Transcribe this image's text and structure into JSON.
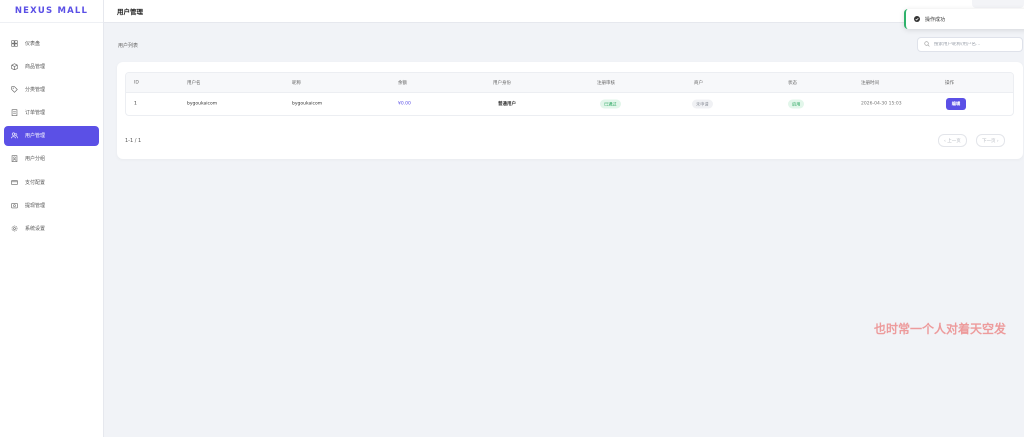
{
  "brand": "NEXUS MALL",
  "header": {
    "title": "用户管理"
  },
  "toast": {
    "message": "操作成功",
    "icon": "check-circle-icon"
  },
  "sidebar": {
    "items": [
      {
        "label": "仪表盘",
        "icon": "dashboard-icon",
        "active": false
      },
      {
        "label": "商品管理",
        "icon": "box-icon",
        "active": false
      },
      {
        "label": "分类管理",
        "icon": "tag-icon",
        "active": false
      },
      {
        "label": "订单管理",
        "icon": "clipboard-icon",
        "active": false
      },
      {
        "label": "用户管理",
        "icon": "users-icon",
        "active": true
      },
      {
        "label": "用户分组",
        "icon": "user-group-icon",
        "active": false
      },
      {
        "label": "支付配置",
        "icon": "card-icon",
        "active": false
      },
      {
        "label": "提现管理",
        "icon": "wallet-icon",
        "active": false
      },
      {
        "label": "系统设置",
        "icon": "gear-icon",
        "active": false
      }
    ]
  },
  "list": {
    "title": "用户列表"
  },
  "search": {
    "placeholder": "搜索用户昵称/用户名...",
    "value": ""
  },
  "table": {
    "headers": [
      "ID",
      "用户名",
      "昵称",
      "余额",
      "用户身份",
      "注册审核",
      "商户",
      "状态",
      "注册时间",
      "操作"
    ],
    "rows": [
      {
        "id": "1",
        "username": "bygoukaicom",
        "nickname": "bygoukaicom",
        "balance": "¥0.00",
        "role": "普通用户",
        "review": "已通过",
        "merchant": "未申请",
        "status": "启用",
        "registered": "2026-04-30 15:03",
        "action": "编辑"
      }
    ]
  },
  "pagination": {
    "info": "1-1 / 1",
    "prev": "‹ 上一页",
    "next": "下一页 ›"
  },
  "watermark": "也时常一个人对着天空发",
  "colors": {
    "accent": "#5b50e6",
    "success": "#23a35a",
    "toast_border": "#2fb26b",
    "watermark": "#ec7878"
  }
}
